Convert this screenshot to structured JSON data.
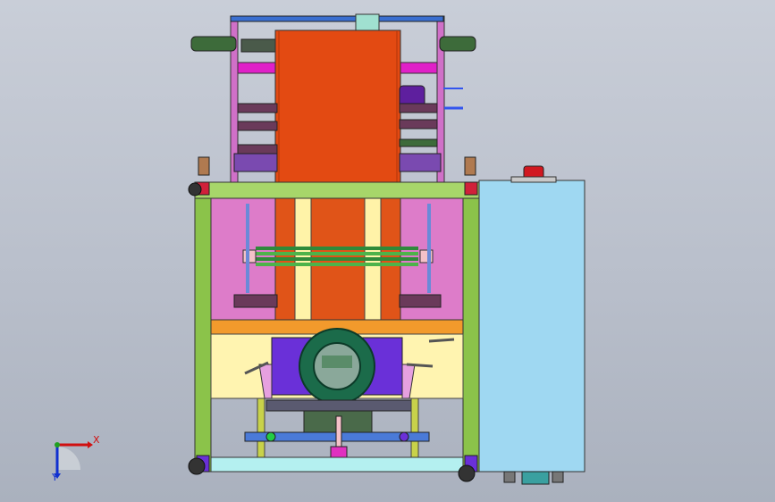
{
  "viewport": {
    "background_top": "#c9ced8",
    "background_bottom": "#aab1be"
  },
  "triad": {
    "x_label": "X",
    "y_label": "Y",
    "x_color": "#d01010",
    "y_color": "#1030d0",
    "z_color": "#20a020"
  },
  "model": {
    "frame_color": "#8bc34a",
    "panel_color": "#e65100",
    "enclosure_color": "#9fd8f2",
    "pink_color": "#e07bd0",
    "cream_color": "#fff3b0",
    "purple_color": "#6a2fd6",
    "ring_color": "#1a6a48"
  }
}
